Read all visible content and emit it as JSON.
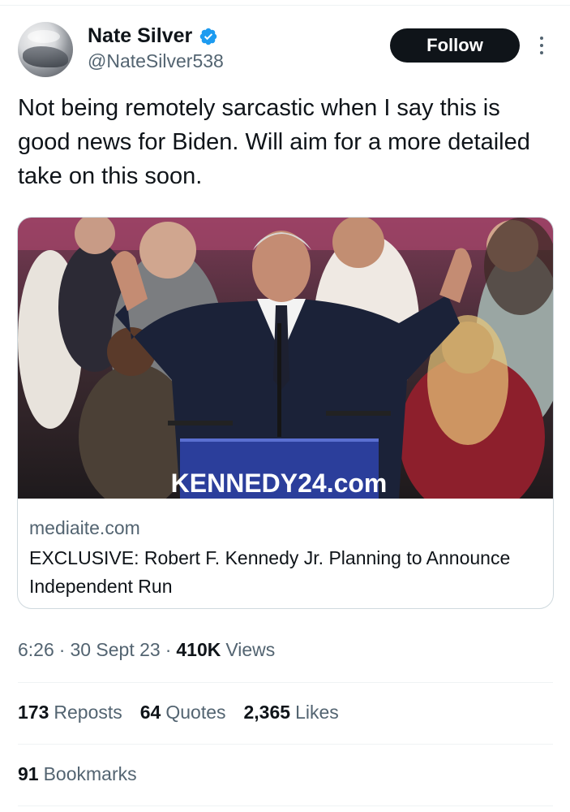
{
  "author": {
    "name": "Nate Silver",
    "handle": "@NateSilver538",
    "verified_icon": "verified-badge-icon",
    "avatar_icon": "avatar-photo"
  },
  "header": {
    "follow_label": "Follow",
    "more_icon": "more-options-icon"
  },
  "tweet": {
    "text": "Not being remotely sarcastic when I say this is good news for Biden. Will aim for a more detailed take on this soon."
  },
  "card": {
    "image_icon": "article-photo",
    "podium_text": "KENNEDY24.com",
    "domain": "mediaite.com",
    "title": "EXCLUSIVE: Robert F. Kennedy Jr. Planning to Announce Independent Run"
  },
  "meta": {
    "time": "6:26",
    "date": "30 Sept 23",
    "views_count": "410K",
    "views_label": "Views"
  },
  "stats": {
    "reposts_count": "173",
    "reposts_label": "Reposts",
    "quotes_count": "64",
    "quotes_label": "Quotes",
    "likes_count": "2,365",
    "likes_label": "Likes",
    "bookmarks_count": "91",
    "bookmarks_label": "Bookmarks"
  },
  "colors": {
    "text_primary": "#0f1419",
    "text_secondary": "#536471",
    "verified_blue": "#1d9bf0",
    "border": "#cfd9de",
    "podium_blue": "#2b3e9b"
  }
}
